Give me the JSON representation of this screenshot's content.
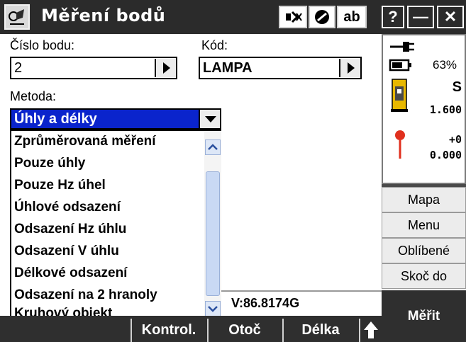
{
  "title": "Měření bodů",
  "titlebar": {
    "ab_label": "ab",
    "help_label": "?",
    "minimize_label": "—",
    "close_label": "✕"
  },
  "form": {
    "point_label": "Číslo bodu:",
    "point_value": "2",
    "code_label": "Kód:",
    "code_value": "LAMPA",
    "method_label": "Metoda:",
    "method_selected": "Úhly a délky",
    "method_options": [
      "Zprůměrovaná měření",
      "Pouze úhly",
      "Pouze Hz úhel",
      "Úhlové odsazení",
      "Odsazení Hz úhlu",
      "Odsazení V úhlu",
      "Délkové odsazení",
      "Odsazení na 2 hranoly",
      "Kruhový objekt"
    ]
  },
  "status": {
    "battery_percent": "63%",
    "instrument_face": "S",
    "instrument_height": "1.600",
    "target_offset": "+0",
    "target_height": "0.000",
    "vertical_angle": "V:86.8174G"
  },
  "side_menu": {
    "map": "Mapa",
    "menu": "Menu",
    "favorites": "Oblíbené",
    "jump_to": "Skoč do"
  },
  "bottom": {
    "check": "Kontrol.",
    "rotate": "Otoč",
    "distance": "Délka",
    "measure": "Měřit"
  },
  "colors": {
    "selection": "#0a24cc",
    "titlebar": "#2b2b2b",
    "bottombar": "#2f2f2f"
  }
}
